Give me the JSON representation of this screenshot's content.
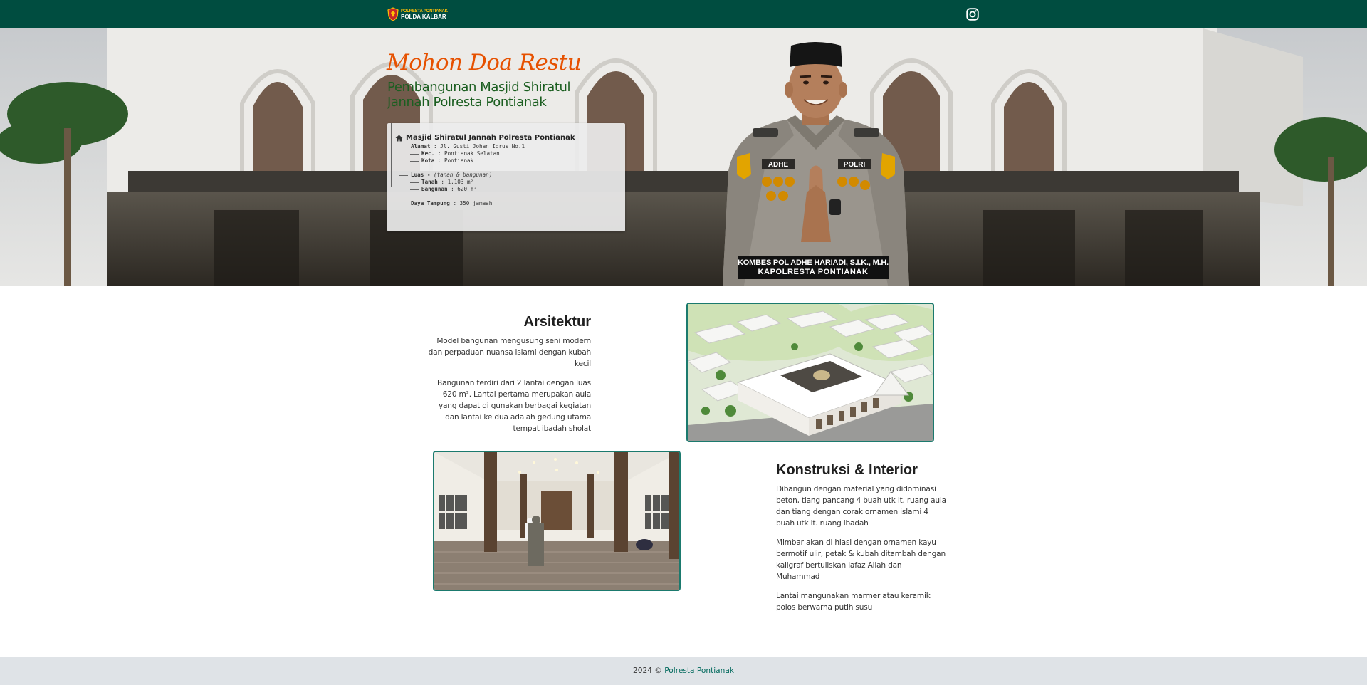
{
  "navbar": {
    "brand_line1": "POLRESTA PONTIANAK",
    "brand_line2": "POLDA KALBAR",
    "social_icon": "instagram-icon",
    "background": "#004d40"
  },
  "hero": {
    "title": "Mohon Doa Restu",
    "subtitle": "Pembangunan Masjid Shiratul Jannah Polresta Pontianak",
    "card": {
      "heading": "Masjid Shiratul Jannah Polresta Pontianak",
      "address_label": "Alamat",
      "address_value": "Jl. Gusti Johan Idrus No.1",
      "district_label": "Kec.",
      "district_value": "Pontianak Selatan",
      "city_label": "Kota",
      "city_value": "Pontianak",
      "area_label": "Luas -",
      "area_note": "(tanah & bangunan)",
      "land_label": "Tanah",
      "land_value": "1.103 m²",
      "building_label": "Bangunan",
      "building_value": "620 m²",
      "capacity_label": "Daya Tampung",
      "capacity_value": "350 jamaah"
    },
    "officer_name": "KOMBES POL ADHE HARIADI, S.I.K., M.H.",
    "officer_title": "KAPOLRESTA PONTIANAK"
  },
  "arsitektur": {
    "title": "Arsitektur",
    "p1": "Model bangunan mengusung seni modern dan perpaduan nuansa islami dengan kubah kecil",
    "p2": "Bangunan terdiri dari 2 lantai dengan luas 620 m². Lantai pertama merupakan aula yang dapat di gunakan berbagai kegiatan dan lantai ke dua adalah gedung utama tempat ibadah sholat"
  },
  "konstruksi": {
    "title": "Konstruksi & Interior",
    "p1": "Dibangun dengan material yang didominasi beton, tiang pancang 4 buah utk lt. ruang aula dan tiang dengan corak ornamen islami 4 buah utk lt. ruang ibadah",
    "p2": "Mimbar akan di hiasi dengan ornamen kayu bermotif ulir, petak & kubah ditambah dengan kaligraf bertuliskan lafaz Allah dan Muhammad",
    "p3": "Lantai mangunakan marmer atau keramik polos berwarna putih susu"
  },
  "footer": {
    "year": "2024 ©",
    "org": "Polresta Pontianak"
  },
  "colors": {
    "accent_green": "#004d40",
    "title_orange": "#e65100",
    "subtitle_green": "#1b5e20",
    "frame_teal": "#1b7a6e"
  }
}
